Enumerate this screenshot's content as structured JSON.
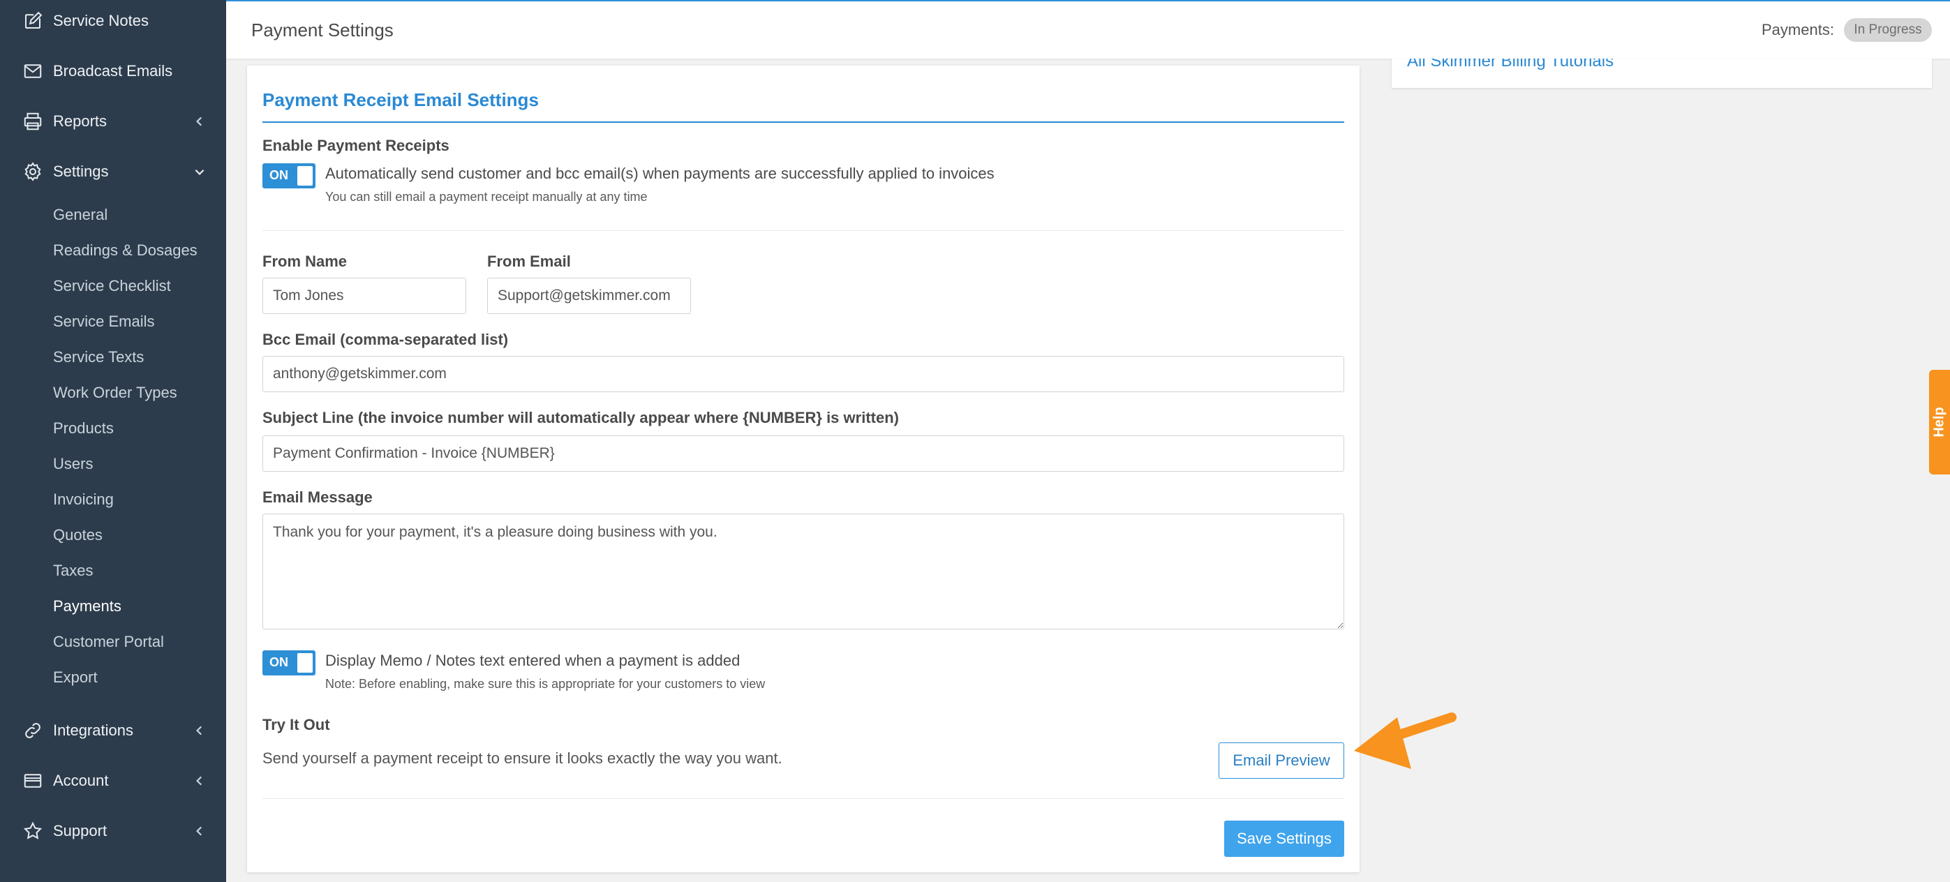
{
  "sidebar": {
    "items": [
      {
        "label": "Service Notes",
        "icon": "edit-icon"
      },
      {
        "label": "Broadcast Emails",
        "icon": "envelope-icon"
      },
      {
        "label": "Reports",
        "icon": "printer-icon"
      },
      {
        "label": "Settings",
        "icon": "gear-icon"
      },
      {
        "label": "Integrations",
        "icon": "link-icon"
      },
      {
        "label": "Account",
        "icon": "credit-card-icon"
      },
      {
        "label": "Support",
        "icon": "star-icon"
      }
    ],
    "settings_subitems": [
      "General",
      "Readings & Dosages",
      "Service Checklist",
      "Service Emails",
      "Service Texts",
      "Work Order Types",
      "Products",
      "Users",
      "Invoicing",
      "Quotes",
      "Taxes",
      "Payments",
      "Customer Portal",
      "Export"
    ],
    "active_subitem": "Payments"
  },
  "header": {
    "title": "Payment Settings",
    "payments_label": "Payments:",
    "payments_status": "In Progress"
  },
  "side_panel": {
    "link": "All Skimmer Billing Tutorials"
  },
  "card": {
    "title": "Payment Receipt Email Settings",
    "enable_receipts": {
      "label": "Enable Payment Receipts",
      "toggle": "ON",
      "description": "Automatically send customer and bcc email(s) when payments are successfully applied to invoices",
      "note": "You can still email a payment receipt manually at any time"
    },
    "from_name": {
      "label": "From Name",
      "value": "Tom Jones"
    },
    "from_email": {
      "label": "From Email",
      "value": "Support@getskimmer.com"
    },
    "bcc_email": {
      "label": "Bcc Email (comma-separated list)",
      "value": "anthony@getskimmer.com"
    },
    "subject_line": {
      "label": "Subject Line (the invoice number will automatically appear where {NUMBER} is written)",
      "value": "Payment Confirmation - Invoice {NUMBER}"
    },
    "email_message": {
      "label": "Email Message",
      "value": "Thank you for your payment, it's a pleasure doing business with you."
    },
    "display_memo": {
      "toggle": "ON",
      "description": "Display Memo / Notes text entered when a payment is added",
      "note": "Note: Before enabling, make sure this is appropriate for your customers to view"
    },
    "try_it_out": {
      "label": "Try It Out",
      "description": "Send yourself a payment receipt to ensure it looks exactly the way you want.",
      "button": "Email Preview"
    },
    "save_button": "Save Settings"
  },
  "help": {
    "label": "Help"
  },
  "colors": {
    "sidebar_bg": "#2d3c4c",
    "accent": "#2d8fd6",
    "help_tab": "#f7931e",
    "annotation_arrow": "#f7931e"
  }
}
